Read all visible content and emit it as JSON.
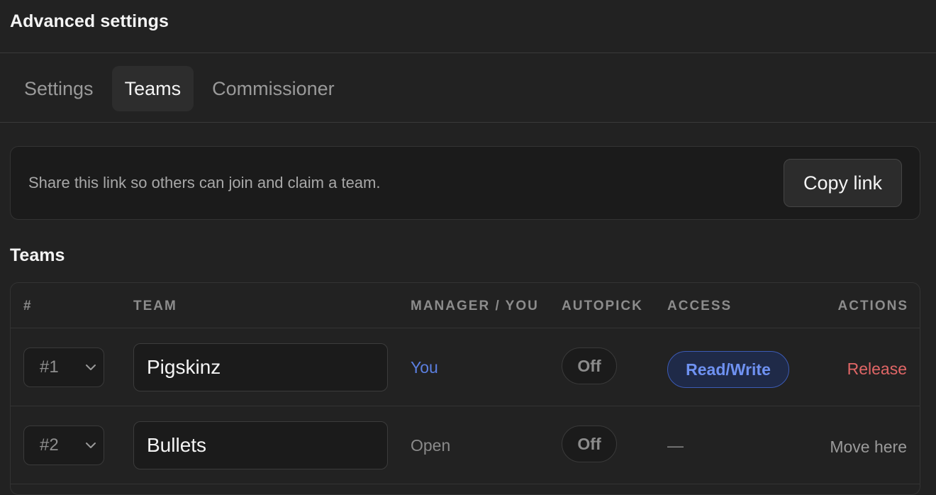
{
  "header": {
    "title": "Advanced settings"
  },
  "tabs": [
    {
      "label": "Settings",
      "active": false
    },
    {
      "label": "Teams",
      "active": true
    },
    {
      "label": "Commissioner",
      "active": false
    }
  ],
  "share": {
    "text": "Share this link so others can join and claim a team.",
    "button_label": "Copy link"
  },
  "teams_section": {
    "title": "Teams",
    "columns": [
      "#",
      "TEAM",
      "MANAGER / YOU",
      "AUTOPICK",
      "ACCESS",
      "ACTIONS"
    ],
    "rows": [
      {
        "slot": "#1",
        "team": "Pigskinz",
        "manager": "You",
        "autopick": "Off",
        "access": "Read/Write",
        "action": "Release"
      },
      {
        "slot": "#2",
        "team": "Bullets",
        "manager": "Open",
        "autopick": "Off",
        "access": "—",
        "action": "Move here"
      }
    ]
  },
  "colors": {
    "background": "#222222",
    "panel": "#1b1b1b",
    "accent_blue": "#5b7fe0",
    "danger_red": "#e06666"
  },
  "icons": {
    "select_chevron": "chevron-down-icon"
  }
}
